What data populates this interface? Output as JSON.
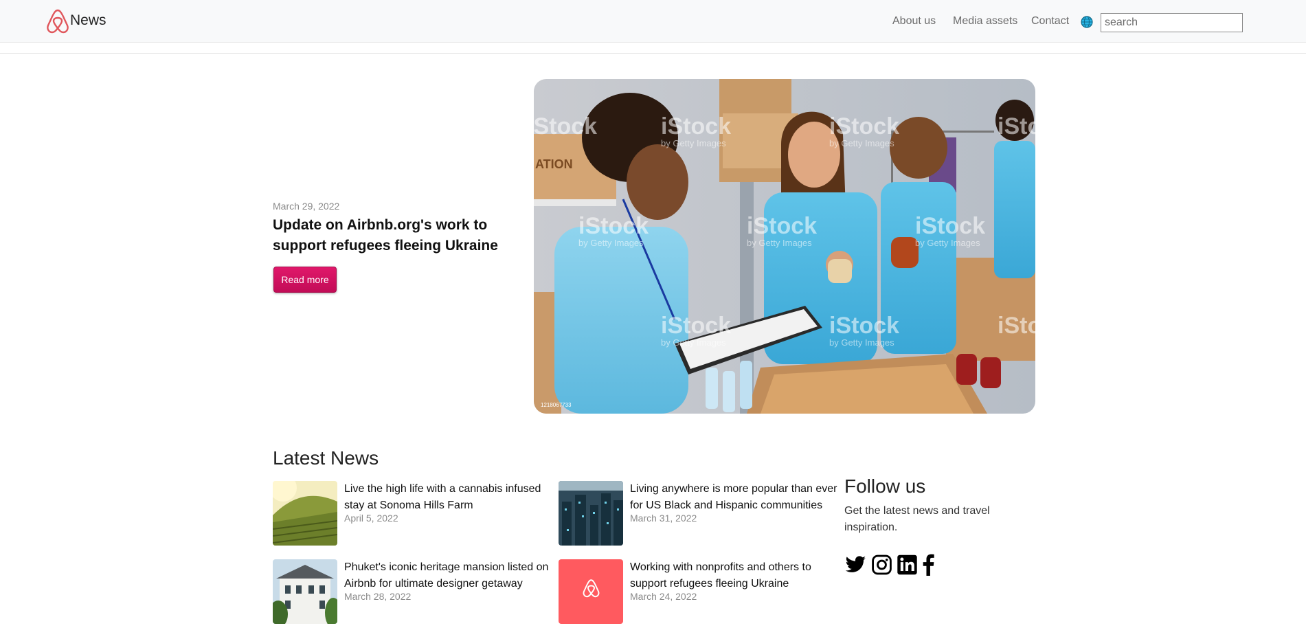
{
  "header": {
    "brand": "News",
    "nav": [
      "About us",
      "Media assets",
      "Contact"
    ],
    "search_placeholder": "search",
    "icons": {
      "logo": "airbnb-logo",
      "language": "globe-icon"
    }
  },
  "hero": {
    "date": "March 29, 2022",
    "title": "Update on Airbnb.org's work to support refugees fleeing Ukraine",
    "button": "Read more",
    "image": {
      "description": "Volunteers in blue shirts sorting donations",
      "watermark_brand": "iStock",
      "watermark_sub": "by Getty Images",
      "box_text": "ATION",
      "stock_id": "1218067733"
    }
  },
  "latest": {
    "title": "Latest News",
    "items": [
      {
        "title": "Live the high life with a cannabis infused stay at Sonoma Hills Farm",
        "date": "April 5, 2022",
        "thumb": "vineyard"
      },
      {
        "title": "Living anywhere is more popular than ever for US Black and Hispanic communities",
        "date": "March 31, 2022",
        "thumb": "city"
      },
      {
        "title": "Phuket's iconic heritage mansion listed on Airbnb for ultimate designer getaway",
        "date": "March 28, 2022",
        "thumb": "mansion"
      },
      {
        "title": "Working with nonprofits and others to support refugees fleeing Ukraine",
        "date": "March 24, 2022",
        "thumb": "airbnb-logo"
      }
    ]
  },
  "follow": {
    "title": "Follow us",
    "text": "Get the latest news and travel inspiration.",
    "icons": [
      "twitter-icon",
      "instagram-icon",
      "linkedin-icon",
      "facebook-icon"
    ]
  },
  "colors": {
    "brand": "#ff5a5f",
    "button": "#d3135f",
    "header_bg": "#f8f9fa"
  }
}
